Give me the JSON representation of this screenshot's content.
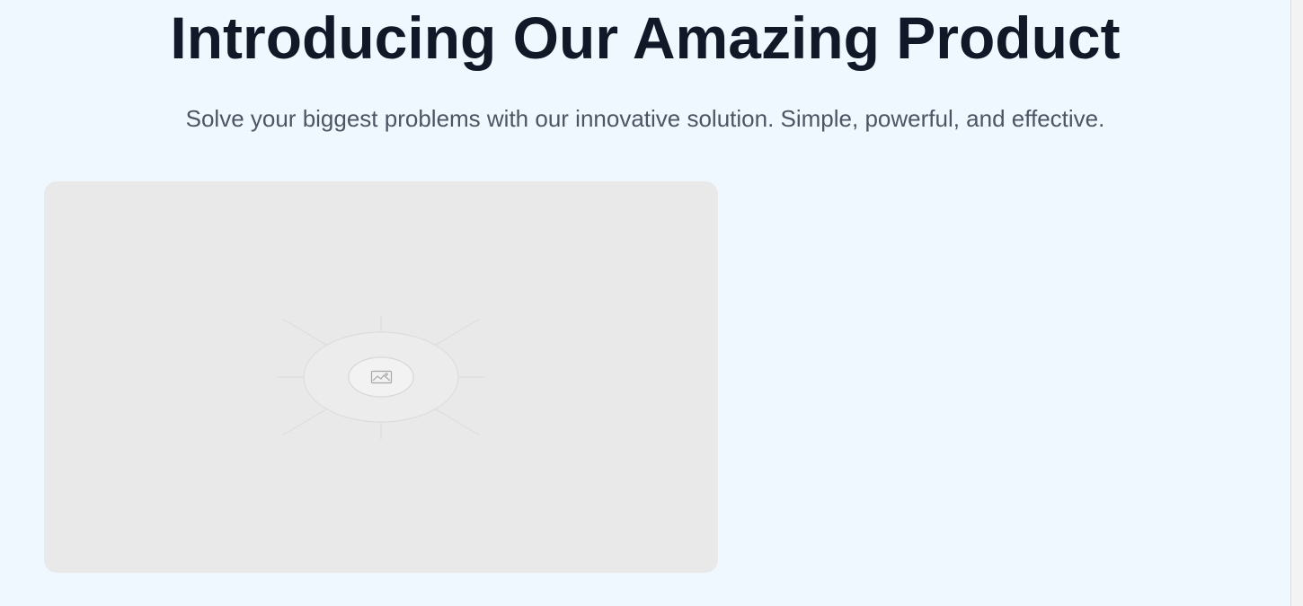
{
  "hero": {
    "title": "Introducing Our Amazing Product",
    "subtitle": "Solve your biggest problems with our innovative solution. Simple, powerful, and effective."
  },
  "media": {
    "icon": "image-icon"
  },
  "colors": {
    "background": "#f0f8ff",
    "title": "#111827",
    "subtitle": "#4b5563",
    "placeholder": "#e9e9e9"
  }
}
